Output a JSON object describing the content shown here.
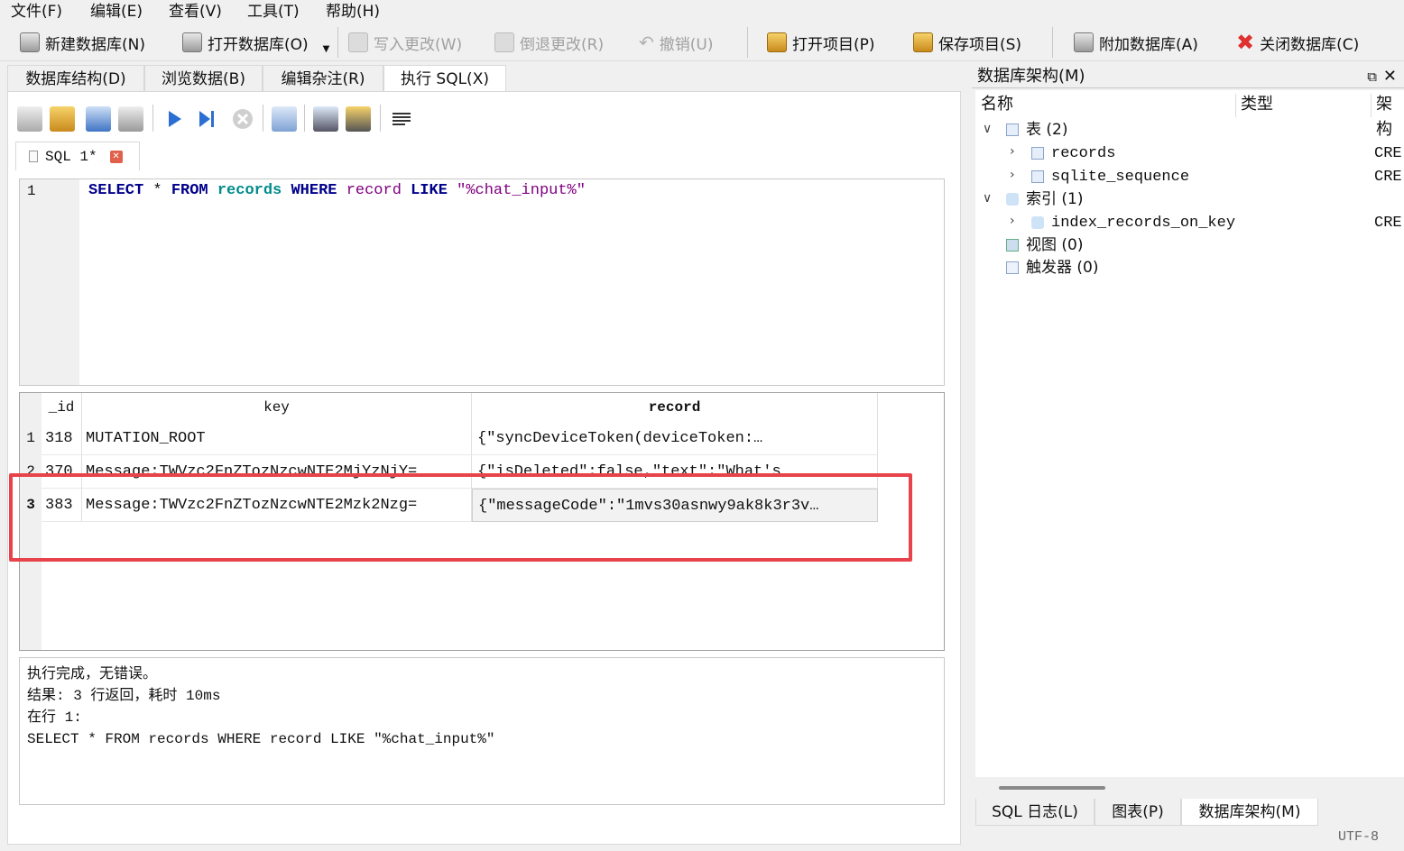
{
  "menu": [
    "文件(F)",
    "编辑(E)",
    "查看(V)",
    "工具(T)",
    "帮助(H)"
  ],
  "toolbar": {
    "new_db": "新建数据库(N)",
    "open_db": "打开数据库(O)",
    "write_changes": "写入更改(W)",
    "revert_changes": "倒退更改(R)",
    "undo": "撤销(U)",
    "open_project": "打开项目(P)",
    "save_project": "保存项目(S)",
    "attach_db": "附加数据库(A)",
    "close_db": "关闭数据库(C)"
  },
  "tabs": [
    "数据库结构(D)",
    "浏览数据(B)",
    "编辑杂注(R)",
    "执行 SQL(X)"
  ],
  "sql_tab": {
    "label": "SQL 1*"
  },
  "editor": {
    "line": "1",
    "kw_select": "SELECT",
    "star": " * ",
    "kw_from": "FROM",
    "table": "records",
    "kw_where": "WHERE",
    "column": "record",
    "kw_like": "LIKE",
    "pattern": "\"%chat_input%\""
  },
  "grid": {
    "columns": [
      "_id",
      "key",
      "record"
    ],
    "rows": [
      {
        "num": "1",
        "id": "318",
        "key": "MUTATION_ROOT",
        "record": "{\"syncDeviceToken(deviceToken:…"
      },
      {
        "num": "2",
        "id": "370",
        "key": "Message:TWVzc2FnZTozNzcwNTE2MjYzNjY=",
        "record": "{\"isDeleted\":false,\"text\":\"What's"
      },
      {
        "num": "3",
        "id": "383",
        "key": "Message:TWVzc2FnZTozNzcwNTE2Mzk2Nzg=",
        "record": "{\"messageCode\":\"1mvs30asnwy9ak8k3r3v…"
      }
    ]
  },
  "log": {
    "line1": "执行完成，无错误。",
    "line2": "结果: 3 行返回，耗时 10ms",
    "line3": "在行 1:",
    "line4": "SELECT * FROM records WHERE record LIKE \"%chat_input%\""
  },
  "schema": {
    "title": "数据库架构(M)",
    "col_name": "名称",
    "col_type": "类型",
    "col_schema": "架构",
    "tables_label": "表 (2)",
    "table1": "records",
    "table2": "sqlite_sequence",
    "indexes_label": "索引 (1)",
    "index1": "index_records_on_key",
    "views_label": "视图 (0)",
    "triggers_label": "触发器 (0)",
    "cre": "CRE"
  },
  "bottom_tabs": [
    "SQL 日志(L)",
    "图表(P)",
    "数据库架构(M)"
  ],
  "status": {
    "encoding": "UTF-8"
  }
}
